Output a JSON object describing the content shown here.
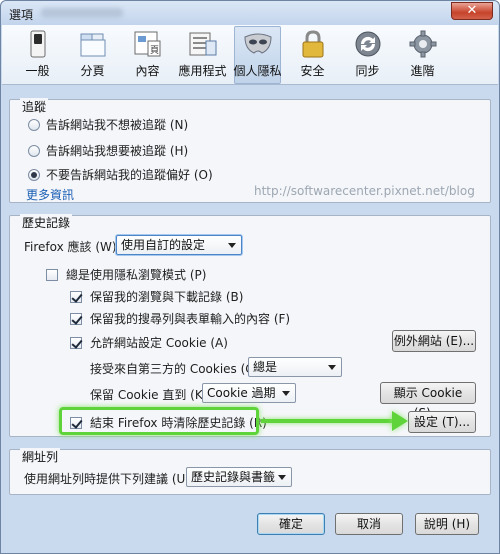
{
  "window": {
    "title": "選項"
  },
  "toolbar": {
    "items": [
      {
        "label": "一般",
        "icon": "switch-icon"
      },
      {
        "label": "分頁",
        "icon": "tabs-icon"
      },
      {
        "label": "內容",
        "icon": "page-icon"
      },
      {
        "label": "應用程式",
        "icon": "applications-icon"
      },
      {
        "label": "個人隱私",
        "icon": "mask-icon",
        "selected": true
      },
      {
        "label": "安全",
        "icon": "padlock-icon"
      },
      {
        "label": "同步",
        "icon": "sync-icon"
      },
      {
        "label": "進階",
        "icon": "gear-icon"
      }
    ]
  },
  "tracking": {
    "legend": "追蹤",
    "options": [
      {
        "label": "告訴網站我不想被追蹤 (N)",
        "checked": false
      },
      {
        "label": "告訴網站我想要被追蹤 (H)",
        "checked": false
      },
      {
        "label": "不要告訴網站我的追蹤偏好 (O)",
        "checked": true
      }
    ],
    "more_info": "更多資訊"
  },
  "watermark": "http://softwarecenter.pixnet.net/blog",
  "history": {
    "legend": "歷史記錄",
    "firefox_will_label": "Firefox 應該 (W):",
    "firefox_will_value": "使用自訂的設定",
    "private_mode": {
      "label": "總是使用隱私瀏覽模式 (P)",
      "checked": false
    },
    "remember_browsing": {
      "label": "保留我的瀏覽與下載記錄 (B)",
      "checked": true
    },
    "remember_search": {
      "label": "保留我的搜尋列與表單輸入的內容 (F)",
      "checked": true
    },
    "accept_cookies": {
      "label": "允許網站設定 Cookie (A)",
      "checked": true
    },
    "exceptions_button": "例外網站 (E)...",
    "third_party_label": "接受來自第三方的 Cookies (C):",
    "third_party_value": "總是",
    "keep_until_label": "保留 Cookie 直到 (K):",
    "keep_until_value": "Cookie 過期",
    "show_cookies_button": "顯示 Cookie (S)...",
    "clear_on_close": {
      "label": "結束 Firefox 時清除歷史記錄 (R)",
      "checked": true
    },
    "settings_button": "設定 (T)..."
  },
  "location_bar": {
    "legend": "網址列",
    "suggest_label": "使用網址列時提供下列建議 (U):",
    "suggest_value": "歷史記錄與書籤"
  },
  "footer": {
    "ok": "確定",
    "cancel": "取消",
    "help": "說明 (H)"
  },
  "colors": {
    "highlight": "#5fd43a",
    "link": "#1b5fb5"
  }
}
